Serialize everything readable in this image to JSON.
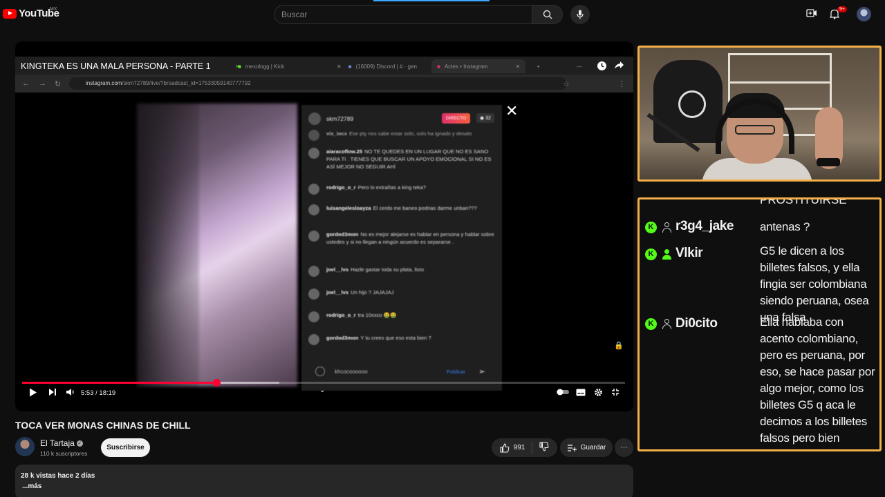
{
  "youtube": {
    "logo_text": "YouTube",
    "region": "MX",
    "search_placeholder": "Buscar",
    "notification_count": "9+"
  },
  "player": {
    "embedded_title": "KINGTEKA ES UNA MALA PERSONA - PARTE 1",
    "browser_tabs": [
      "mexologg | Kick",
      "(16009) Discord | # · gen",
      "Actes • Instagram"
    ],
    "url_domain": "instagram.com",
    "url_path": "/skm72789/live/?broadcast_id=17533059140777792",
    "time": "5:53 / 18:19",
    "progress_fraction": 0.322,
    "buffered_fraction": 0.427
  },
  "instagram": {
    "host": "skm72789",
    "live_label": "DIRECTO",
    "viewers": "32",
    "comments": [
      {
        "user": "vix_iocx",
        "text": "Ese pty nos sabe estar solo, solo ha ignado y desato"
      },
      {
        "user": "aiaracoflow.25",
        "text": "NO TE QUEDES EN UN LUGAR QUE NO ES SANO PARA TI . TIENES QUE BUSCAR UN APOYO EMOCIONAL SI NO ES ASÍ MEJOR NO SEGUIR AHÍ"
      },
      {
        "user": "rodrigo_o_r",
        "text": "Pero lo extrañas a king teka?"
      },
      {
        "user": "luisangelesloayza",
        "text": "El cerdo me baneo podrias darme unban???"
      },
      {
        "user": "gordod3mon",
        "text": "No es mejor alejarse es hablar en persona y hablar sobre ustedes y si no llegan a ningún acuerdo es separarse ."
      },
      {
        "user": "joel__lvs",
        "text": "Hazle gastar toda su plata, listo"
      },
      {
        "user": "joel__lvs",
        "text": "Un hijo ? JAJAJAJ"
      },
      {
        "user": "rodrigo_o_r",
        "text": "tra 10xxco 🤮🤮"
      },
      {
        "user": "gordod3mon",
        "text": "Y tu crees que eso esta bien ?"
      }
    ],
    "input_value": "khcocoooooo",
    "publish_label": "Publicar"
  },
  "video": {
    "title": "TOCA VER MONAS CHINAS DE CHILL",
    "channel": "El Tartaja",
    "subscribers": "110 k suscriptores",
    "subscribe_label": "Suscribirse",
    "likes": "991",
    "save_label": "Guardar",
    "views_date": "28 k vistas  hace 2 días",
    "more_label": "...más"
  },
  "chat": {
    "cut_top_text": "PROSTITUIRSE",
    "messages": [
      {
        "user": "r3g4_jake",
        "text": "antenas ?",
        "badge_color": "#cfcfcf"
      },
      {
        "user": "Vlkir",
        "text": "G5 le dicen a los billetes falsos, y ella fingia ser colombiana siendo peruana, osea una falsa",
        "badge_color": "#53fc18"
      },
      {
        "user": "Di0cito",
        "text": "Ella hablaba con acento colombiano, pero es peruana, por eso, se hace pasar por algo mejor, como los billetes G5 q aca le decimos a los billetes falsos pero bien hechos",
        "badge_color": "#cfcfcf"
      }
    ]
  },
  "colors": {
    "accent_red": "#ff0033",
    "overlay_border": "#f3b04a",
    "kick_green": "#53fc18"
  }
}
